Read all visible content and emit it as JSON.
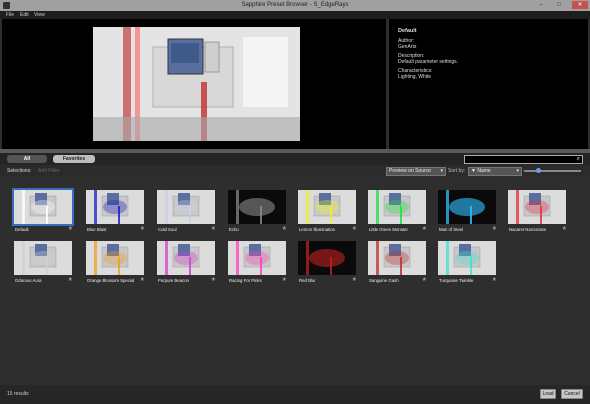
{
  "window": {
    "title": "Sapphire Preset Browser - S_EdgeRays",
    "minimize": "–",
    "maximize": "□",
    "close": "✕"
  },
  "menu": [
    "File",
    "Edit",
    "View"
  ],
  "info": {
    "name": "Default",
    "author_label": "Author:",
    "author": "GenArts",
    "description_label": "Description:",
    "description": "Default parameter settings.",
    "characteristics_label": "Characteristics:",
    "characteristics": "Lighting, White"
  },
  "tabs": {
    "all": "All",
    "favorites": "Favorites"
  },
  "search": {
    "placeholder": "",
    "icon": "search-icon"
  },
  "filter": {
    "selections_label": "Selections:",
    "add_filter_placeholder": "Add Filter",
    "preview_mode": "Preview on Source",
    "sort_label": "Sort by:",
    "sort_value": "Name",
    "thumbnail_size_fraction": 0.25
  },
  "presets": [
    {
      "name": "Default",
      "color": "#ffffff",
      "selected": true
    },
    {
      "name": "Blue Blast",
      "color": "#2020c0"
    },
    {
      "name": "Cold Soul",
      "color": "#c8d0e8"
    },
    {
      "name": "Echo",
      "color": "#888888"
    },
    {
      "name": "Lemon Illumination",
      "color": "#f0f020"
    },
    {
      "name": "Little Green Monster",
      "color": "#20e040"
    },
    {
      "name": "Man of Steel",
      "color": "#30c0ff"
    },
    {
      "name": "Nacaret Narcissism",
      "color": "#e03040"
    },
    {
      "name": "Odorous Aura",
      "color": "#d0d0d0"
    },
    {
      "name": "Orange Blossom Special",
      "color": "#f0a020"
    },
    {
      "name": "Purpure Beacon",
      "color": "#d040d0"
    },
    {
      "name": "Racing For Pinks",
      "color": "#ff40c0"
    },
    {
      "name": "Red Blur",
      "color": "#c02020"
    },
    {
      "name": "Sanguine Gash",
      "color": "#c03030"
    },
    {
      "name": "Turquoise Twinkle",
      "color": "#40e0d0"
    }
  ],
  "results": "15 results",
  "buttons": {
    "load": "Load",
    "cancel": "Cancel"
  }
}
